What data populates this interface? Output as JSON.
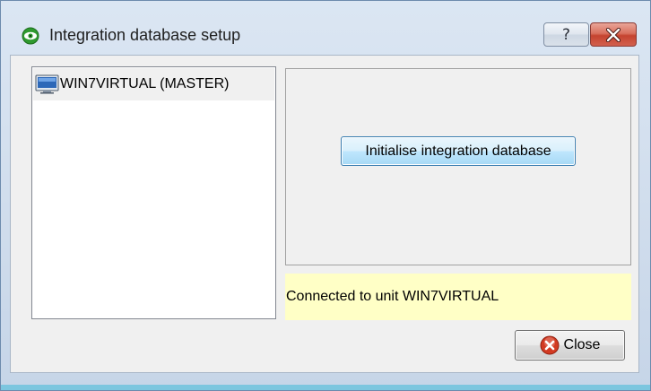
{
  "window": {
    "title": "Integration database setup",
    "app_icon": "eye-icon",
    "help_button_glyph": "?",
    "close_button_glyph": "✕"
  },
  "unit_list": {
    "items": [
      {
        "label": "WIN7VIRTUAL (MASTER)",
        "icon": "computer-icon"
      }
    ]
  },
  "actions": {
    "initialise_label": "Initialise integration database"
  },
  "status": {
    "message": "Connected to unit WIN7VIRTUAL"
  },
  "footer": {
    "close_label": "Close",
    "close_icon": "close-circle-icon"
  },
  "colors": {
    "status_background": "#ffffc6",
    "close_icon_red": "#d23a22",
    "title_close_red": "#c5432f"
  }
}
